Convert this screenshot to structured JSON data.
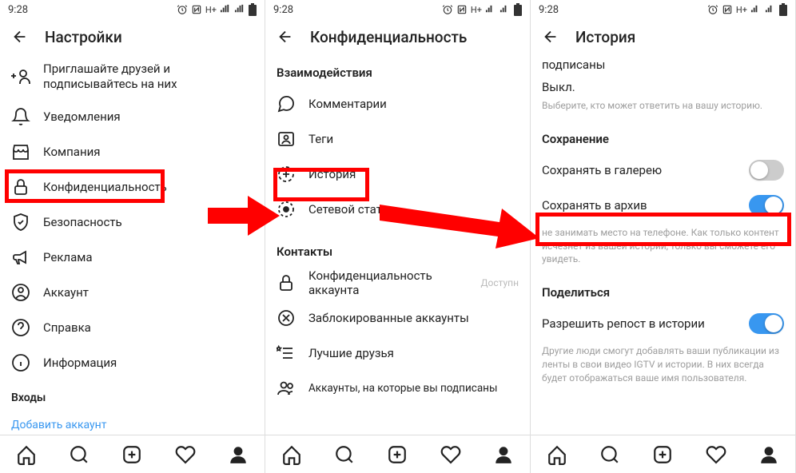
{
  "statusbar": {
    "time": "9:28",
    "net": "H+"
  },
  "screen1": {
    "title": "Настройки",
    "items": {
      "invite": "Приглашайте друзей и подписывайтесь на них",
      "notifications": "Уведомления",
      "business": "Компания",
      "privacy": "Конфиденциальность",
      "security": "Безопасность",
      "ads": "Реклама",
      "account": "Аккаунт",
      "help": "Справка",
      "about": "Информация"
    },
    "section_logins": "Входы",
    "add_account": "Добавить аккаунт"
  },
  "screen2": {
    "title": "Конфиденциальность",
    "section_interactions": "Взаимодействия",
    "items": {
      "comments": "Комментарии",
      "tags": "Теги",
      "story": "История",
      "activity_status": "Сетевой статус"
    },
    "section_contacts": "Контакты",
    "contacts": {
      "account_privacy": "Конфиденциальность аккаунта",
      "account_privacy_state": "Доступн",
      "blocked": "Заблокированные аккаунты",
      "close_friends": "Лучшие друзья",
      "following": "Аккаунты, на которые вы подписаны"
    }
  },
  "screen3": {
    "title": "История",
    "subscribed": "подписаны",
    "off": "Выкл.",
    "reply_hint": "Выберите, кто может ответить на вашу историю.",
    "section_save": "Сохранение",
    "save_gallery": "Сохранять в галерею",
    "save_archive": "Сохранять в архив",
    "archive_hint": "не занимать место на телефоне. Как только контент исчезнет из вашей истории, только вы сможете его увидеть.",
    "section_share": "Поделиться",
    "allow_reshare": "Разрешить репост в истории",
    "share_hint": "Другие люди смогут добавлять ваши публикации из ленты в свои видео IGTV и истории. В них всегда будет отображаться ваше имя пользователя."
  }
}
